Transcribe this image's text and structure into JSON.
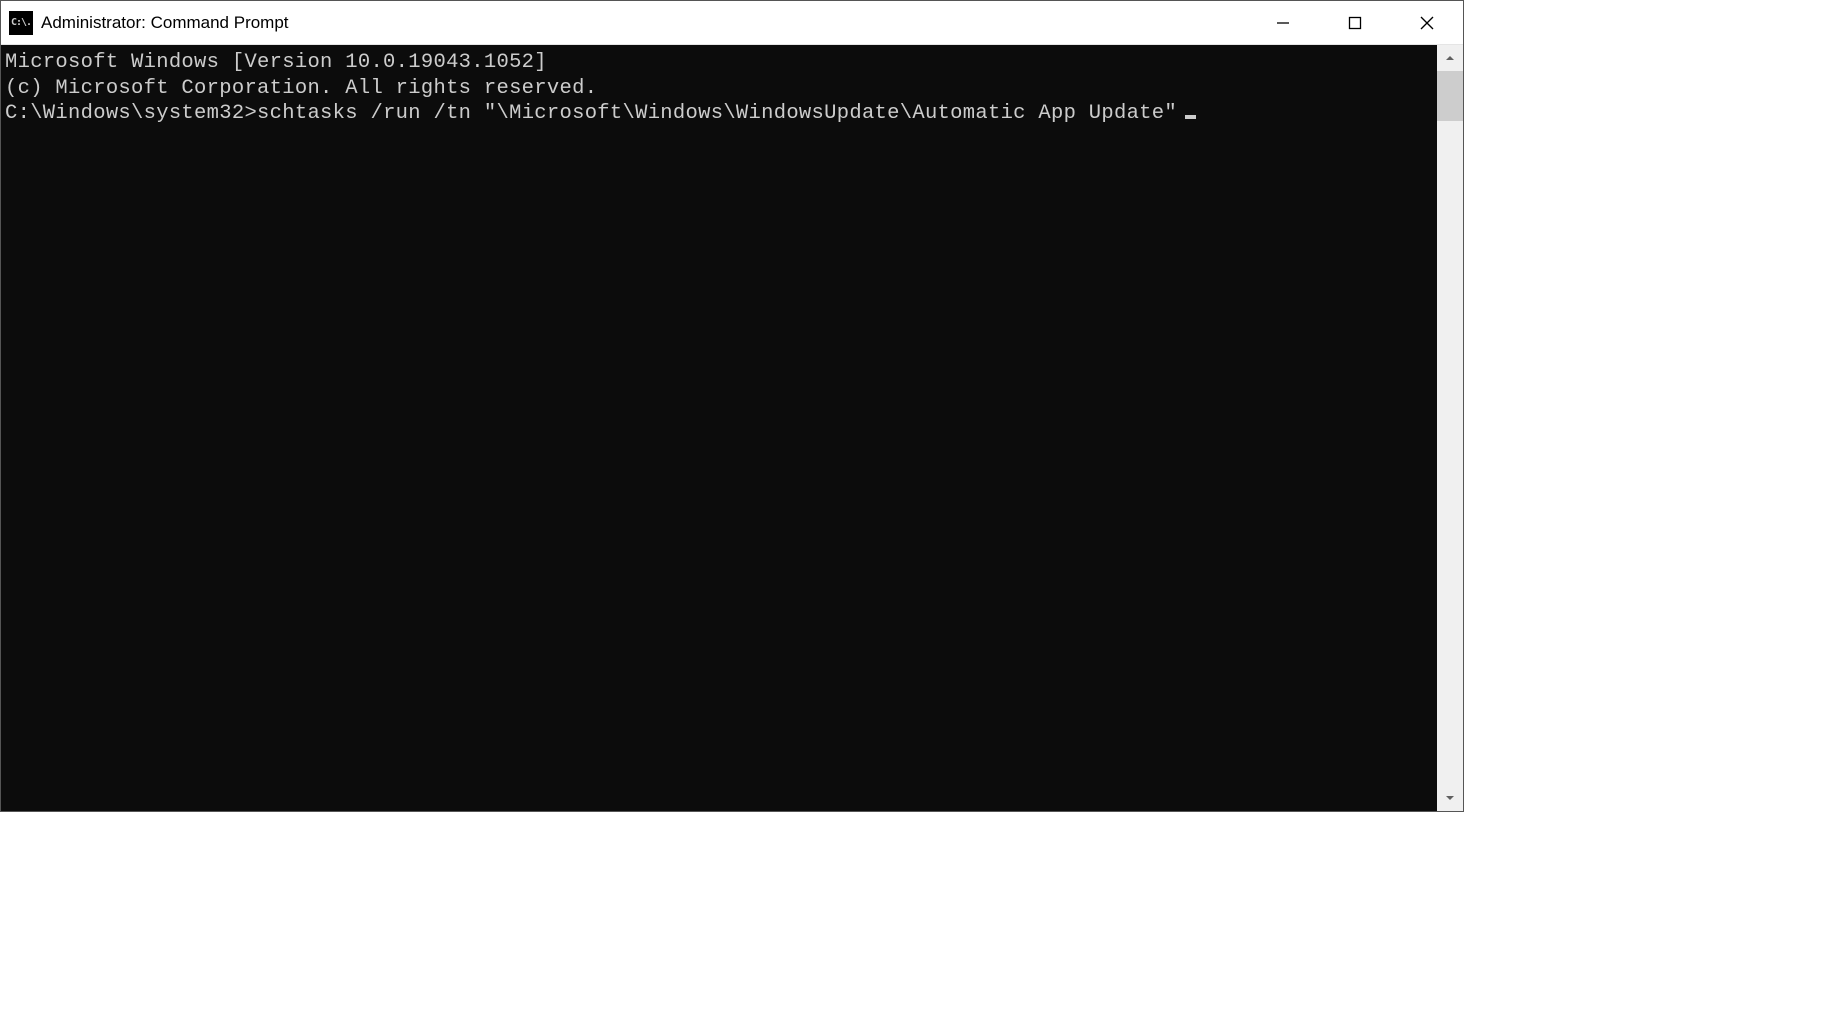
{
  "window": {
    "title": "Administrator: Command Prompt",
    "app_icon_text": "C:\\."
  },
  "terminal": {
    "header_line1": "Microsoft Windows [Version 10.0.19043.1052]",
    "header_line2": "(c) Microsoft Corporation. All rights reserved.",
    "blank": "",
    "prompt_path": "C:\\Windows\\system32>",
    "command": "schtasks /run /tn \"\\Microsoft\\Windows\\WindowsUpdate\\Automatic App Update\""
  }
}
